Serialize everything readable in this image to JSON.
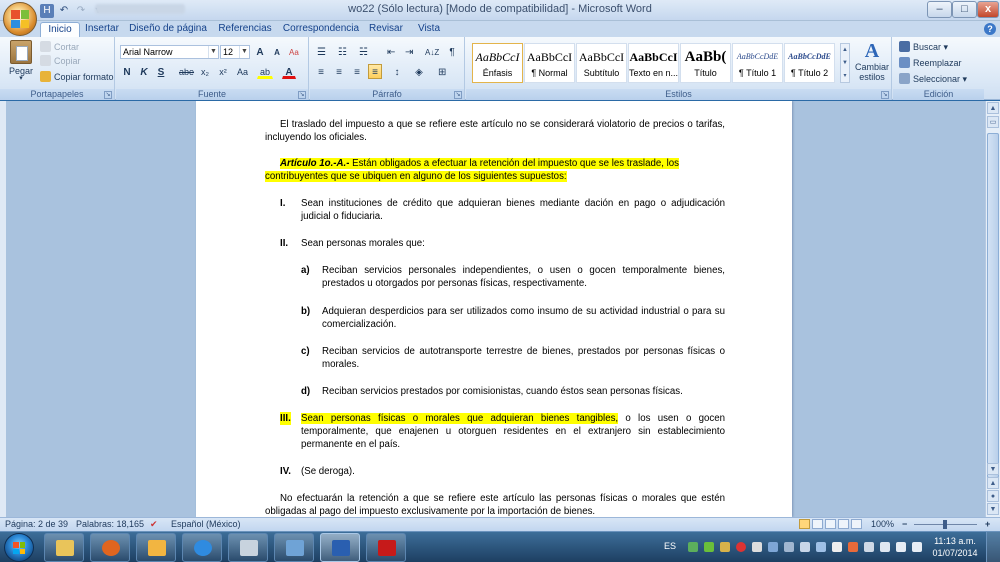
{
  "window": {
    "title": "wo22 (Sólo lectura) [Modo de compatibilidad] - Microsoft Word",
    "minimize": "–",
    "maximize": "□",
    "close": "x"
  },
  "qat": {
    "save": "H",
    "undo": "↶",
    "redo": "↷",
    "customize": "▾"
  },
  "tabs": [
    "Inicio",
    "Insertar",
    "Diseño de página",
    "Referencias",
    "Correspondencia",
    "Revisar",
    "Vista"
  ],
  "help": "?",
  "ribbon": {
    "clipboard": {
      "label": "Portapapeles",
      "paste": "Pegar",
      "cut": "Cortar",
      "copy": "Copiar",
      "format_painter": "Copiar formato"
    },
    "font": {
      "label": "Fuente",
      "font_name": "Arial Narrow",
      "font_size": "12",
      "grow": "A",
      "shrink": "A",
      "clear": "Aa",
      "bold": "N",
      "italic": "K",
      "underline": "S",
      "strike": "abe",
      "subscript": "x₂",
      "superscript": "x²",
      "change_case": "Aa",
      "highlight": "ab",
      "font_color": "A"
    },
    "paragraph": {
      "label": "Párrafo",
      "bullets": "☰",
      "numbering": "☷",
      "multilevel": "☵",
      "decrease_indent": "⇤",
      "increase_indent": "⇥",
      "sort": "A↓Z",
      "show_marks": "¶",
      "align_left": "≡",
      "align_center": "≡",
      "align_right": "≡",
      "justify": "≡",
      "line_spacing": "↕",
      "shading": "◈",
      "borders": "⊞"
    },
    "styles": {
      "label": "Estilos",
      "items": [
        {
          "sample": "AaBbCcI",
          "name": "Énfasis"
        },
        {
          "sample": "AaBbCcI",
          "name": "¶ Normal"
        },
        {
          "sample": "AaBbCcI",
          "name": "Subtítulo"
        },
        {
          "sample": "AaBbCcI",
          "name": "Texto en n..."
        },
        {
          "sample": "AaBb(",
          "name": "Título"
        },
        {
          "sample": "AaBbCcDdE",
          "name": "¶ Título 1"
        },
        {
          "sample": "AaBbCcDdE",
          "name": "¶ Título 2"
        }
      ],
      "change_styles": "Cambiar estilos",
      "change_styles_icon": "A"
    },
    "editing": {
      "label": "Edición",
      "find": "Buscar",
      "replace": "Reemplazar",
      "select": "Seleccionar"
    }
  },
  "document": {
    "p1": "El traslado del impuesto a que se refiere este artículo no se considerará violatorio de precios o tarifas, incluyendo los oficiales.",
    "art_title": "Artículo 1o.-A.-",
    "art_line1": " Están obligados a efectuar la retención del impuesto que se les traslade, los",
    "art_line2": "contribuyentes que se ubiquen en alguno de los siguientes supuestos:",
    "i_mark": "I.",
    "i_text": "Sean instituciones de crédito que adquieran bienes mediante dación en pago o adjudicación judicial o fiduciaria.",
    "ii_mark": "II.",
    "ii_text": "Sean personas morales que:",
    "a_mark": "a)",
    "a_text": "Reciban servicios personales independientes, o usen o gocen temporalmente bienes, prestados u otorgados por personas físicas, respectivamente.",
    "b_mark": "b)",
    "b_text": "Adquieran desperdicios para ser utilizados como insumo de su actividad industrial o para su comercialización.",
    "c_mark": "c)",
    "c_text": "Reciban servicios de autotransporte terrestre de bienes, prestados por personas físicas o morales.",
    "d_mark": "d)",
    "d_text": "Reciban servicios prestados por comisionistas, cuando éstos sean personas físicas.",
    "iii_mark": "III.",
    "iii_hl": "Sean personas físicas o morales que adquieran bienes tangibles,",
    "iii_rest": " o los usen o gocen temporalmente, que enajenen u otorguen residentes en el extranjero sin establecimiento permanente en el país.",
    "iv_mark": "IV.",
    "iv_text": "(Se deroga).",
    "p_last": "No efectuarán la retención a que se refiere este artículo las personas físicas o morales que estén obligadas al pago del impuesto exclusivamente por la importación de bienes."
  },
  "status": {
    "page": "Página: 2 de 39",
    "words": "Palabras: 18,165",
    "language": "Español (México)",
    "zoom": "100%",
    "zoom_minus": "−",
    "zoom_plus": "+"
  },
  "taskbar": {
    "lang": "ES",
    "time": "11:13 a.m.",
    "date": "01/07/2014"
  },
  "colors": {
    "highlight": "#ffff00",
    "ribbon_bg": "#dbe8f6",
    "doc_bg": "#a9c2de"
  }
}
